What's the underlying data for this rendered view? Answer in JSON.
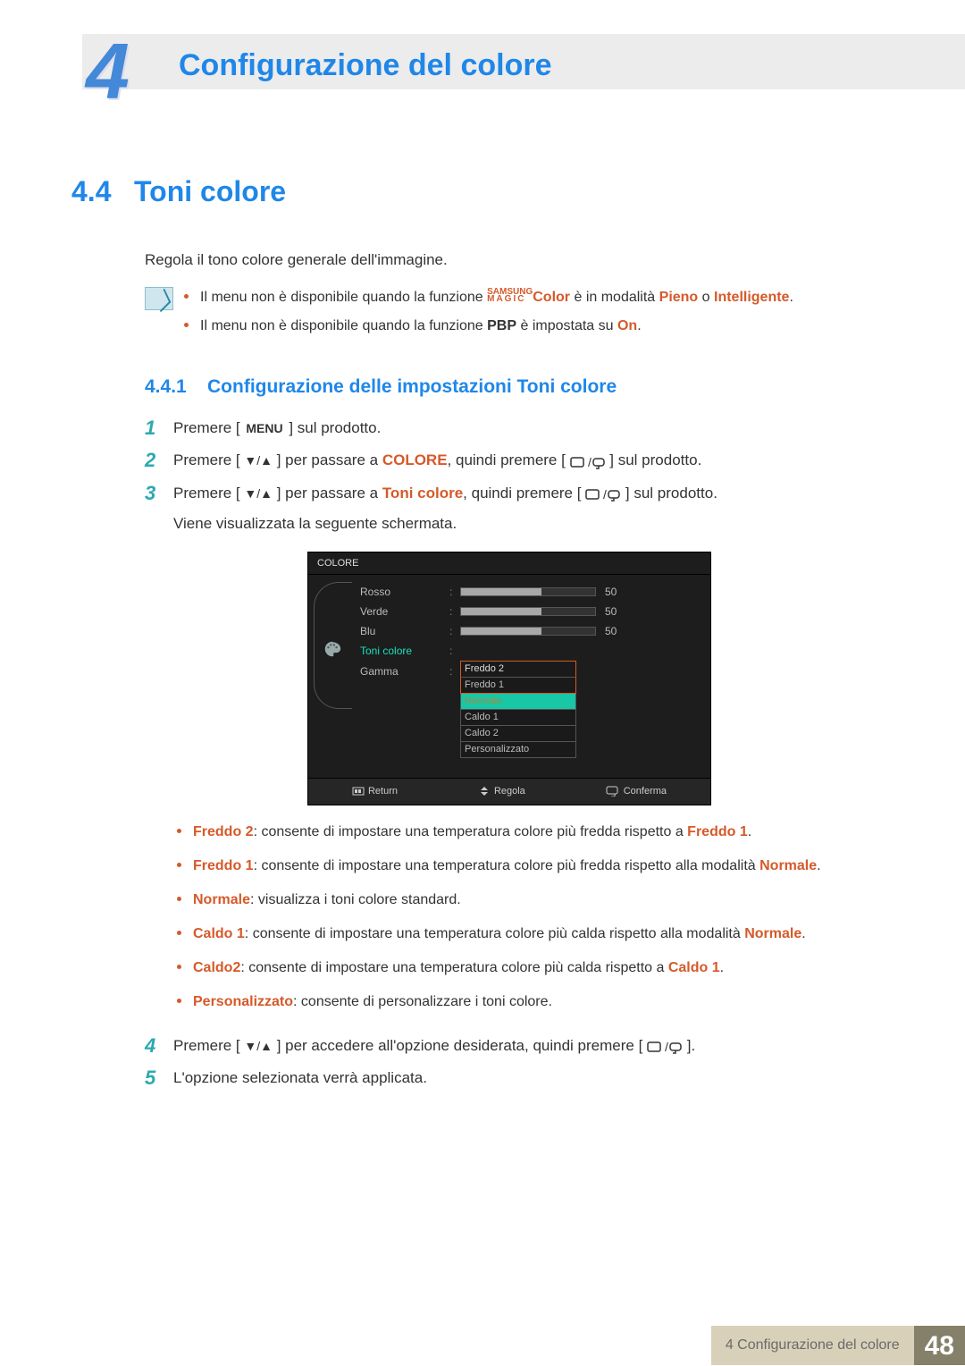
{
  "chapter": {
    "number": "4",
    "title": "Configurazione del colore"
  },
  "section": {
    "number": "4.4",
    "title": "Toni colore",
    "intro": "Regola il tono colore generale dell'immagine."
  },
  "notes": {
    "n1": {
      "pre": "Il menu non è disponibile quando la funzione ",
      "magic_top": "SAMSUNG",
      "magic_bot": "MAGIC",
      "color_word": "Color",
      "mid": " è in modalità ",
      "m1": "Pieno",
      "or": " o ",
      "m2": "Intelligente",
      "post": "."
    },
    "n2": {
      "pre": "Il menu non è disponibile quando la funzione ",
      "pbp": "PBP",
      "mid": " è impostata su ",
      "on": "On",
      "post": "."
    }
  },
  "subsection": {
    "number": "4.4.1",
    "title": "Configurazione delle impostazioni Toni colore"
  },
  "steps": {
    "s1": {
      "pre": "Premere [ ",
      "menu": "MENU",
      "post": " ] sul prodotto."
    },
    "s2": {
      "pre": "Premere [ ",
      "arr": "▼/▲",
      "mid": " ] per passare a ",
      "tgt": "COLORE",
      "mid2": ", quindi premere [ ",
      "post": " ] sul prodotto."
    },
    "s3": {
      "pre": "Premere [ ",
      "arr": "▼/▲",
      "mid": " ] per passare a ",
      "tgt": "Toni colore",
      "mid2": ", quindi premere [ ",
      "post": " ] sul prodotto.",
      "after": "Viene visualizzata la seguente schermata."
    },
    "s4": {
      "pre": "Premere [ ",
      "arr": "▼/▲",
      "mid": " ] per accedere all'opzione desiderata, quindi premere [ ",
      "post": " ]."
    },
    "s5": {
      "txt": "L'opzione selezionata verrà applicata."
    }
  },
  "osd": {
    "title": "COLORE",
    "rows": {
      "r1": {
        "label": "Rosso",
        "val": "50",
        "fill": 60
      },
      "r2": {
        "label": "Verde",
        "val": "50",
        "fill": 60
      },
      "r3": {
        "label": "Blu",
        "val": "50",
        "fill": 60
      },
      "r4": {
        "label": "Toni colore"
      },
      "r5": {
        "label": "Gamma"
      }
    },
    "dropdown": [
      "Freddo 2",
      "Freddo 1",
      "Normale",
      "Caldo 1",
      "Caldo 2",
      "Personalizzato"
    ],
    "footer": {
      "a": "Return",
      "b": "Regola",
      "c": "Conferma"
    }
  },
  "options": {
    "o1": {
      "name": "Freddo 2",
      "desc": ": consente di impostare una temperatura colore più fredda rispetto a ",
      "ref": "Freddo 1",
      "post": "."
    },
    "o2": {
      "name": "Freddo 1",
      "desc": ": consente di impostare una temperatura colore più fredda rispetto alla modalità ",
      "ref": "Normale",
      "post": "."
    },
    "o3": {
      "name": "Normale",
      "desc": ": visualizza i toni colore standard."
    },
    "o4": {
      "name": "Caldo 1",
      "desc": ": consente di impostare una temperatura colore più calda rispetto alla modalità ",
      "ref": "Normale",
      "post": "."
    },
    "o5": {
      "name": "Caldo2",
      "desc": ": consente di impostare una temperatura colore più calda rispetto a ",
      "ref": "Caldo 1",
      "post": "."
    },
    "o6": {
      "name": "Personalizzato",
      "desc": ": consente di personalizzare i toni colore."
    }
  },
  "footer": {
    "text": "4 Configurazione del colore",
    "page": "48"
  }
}
